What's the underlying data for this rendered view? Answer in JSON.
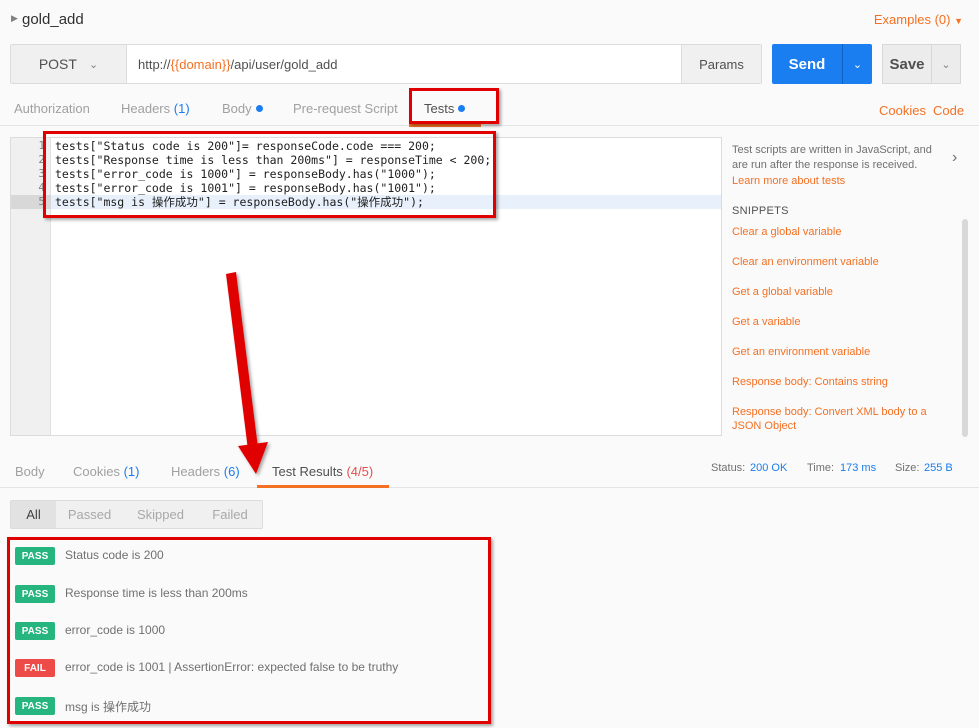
{
  "request": {
    "name": "gold_add",
    "examples_label": "Examples (0)",
    "method": "POST",
    "url_prefix": "http://",
    "url_var": "{{domain}}",
    "url_path": "/api/user/gold_add",
    "params_label": "Params",
    "send_label": "Send",
    "save_label": "Save"
  },
  "req_tabs": {
    "authorization": "Authorization",
    "headers": "Headers",
    "headers_count": "(1)",
    "body": "Body",
    "prerequest": "Pre-request Script",
    "tests": "Tests",
    "cookies": "Cookies",
    "code": "Code"
  },
  "editor": {
    "line_numbers": [
      "1",
      "2",
      "3",
      "4",
      "5"
    ],
    "lines": [
      "tests[\"Status code is 200\"]= responseCode.code === 200;",
      "tests[\"Response time is less than 200ms\"] = responseTime < 200;",
      "tests[\"error_code is 1000\"] = responseBody.has(\"1000\");",
      "tests[\"error_code is 1001\"] = responseBody.has(\"1001\");",
      "tests[\"msg is 操作成功\"] = responseBody.has(\"操作成功\");"
    ]
  },
  "snippets": {
    "description": "Test scripts are written in JavaScript, and are run after the response is received.",
    "learn_more": "Learn more about tests",
    "heading": "SNIPPETS",
    "items": [
      "Clear a global variable",
      "Clear an environment variable",
      "Get a global variable",
      "Get a variable",
      "Get an environment variable",
      "Response body: Contains string",
      "Response body: Convert XML body to a JSON Object"
    ]
  },
  "resp_tabs": {
    "body": "Body",
    "cookies": "Cookies",
    "cookies_count": "(1)",
    "headers": "Headers",
    "headers_count": "(6)",
    "test_results": "Test Results",
    "test_results_count": "(4/5)"
  },
  "status": {
    "status_label": "Status:",
    "status_value": "200 OK",
    "time_label": "Time:",
    "time_value": "173 ms",
    "size_label": "Size:",
    "size_value": "255 B"
  },
  "filters": [
    "All",
    "Passed",
    "Skipped",
    "Failed"
  ],
  "results": [
    {
      "status": "PASS",
      "text": "Status code is 200"
    },
    {
      "status": "PASS",
      "text": "Response time is less than 200ms"
    },
    {
      "status": "PASS",
      "text": "error_code is 1000"
    },
    {
      "status": "FAIL",
      "text": "error_code is 1001 | AssertionError: expected false to be truthy"
    },
    {
      "status": "PASS",
      "text": "msg is 操作成功"
    }
  ],
  "colors": {
    "accent": "#f47023",
    "primary": "#1a7df0",
    "pass": "#26b47f",
    "fail": "#ed4b48",
    "annotation": "#e00000"
  }
}
